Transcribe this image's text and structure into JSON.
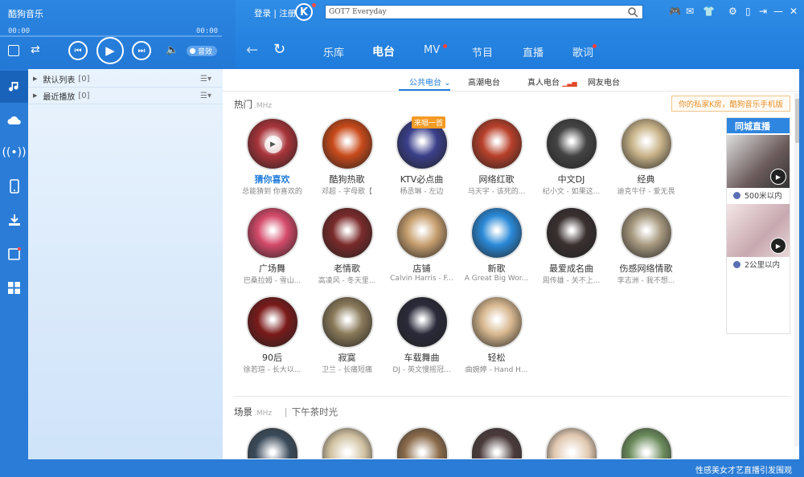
{
  "app": {
    "title": "酷狗音乐"
  },
  "player": {
    "time_current": "00:00",
    "time_total": "00:00",
    "fx_label": "音效"
  },
  "header": {
    "login": "登录",
    "divider": "|",
    "register": "注册",
    "search_value": "GOT7 Everyday"
  },
  "tabs": [
    {
      "label": "乐库"
    },
    {
      "label": "电台"
    },
    {
      "label": "MV"
    },
    {
      "label": "节目"
    },
    {
      "label": "直播"
    },
    {
      "label": "歌词"
    }
  ],
  "playlist": {
    "items": [
      {
        "label": "默认列表",
        "count": "[0]"
      },
      {
        "label": "最近播放",
        "count": "[0]"
      }
    ]
  },
  "subtabs": [
    {
      "label": "公共电台"
    },
    {
      "label": "高潮电台"
    },
    {
      "label": "真人电台"
    },
    {
      "label": "网友电台"
    }
  ],
  "sections": {
    "hot": {
      "title": "热门",
      "sub": ".MHz"
    },
    "scene": {
      "title": "场景",
      "sub": ".MHz",
      "tag": "下午茶时光"
    }
  },
  "promo": "你的私家K房，酷狗音乐手机版",
  "stations": [
    {
      "title": "猜你喜欢",
      "sub": "总能猜到 你喜欢的",
      "color": "#a8343a"
    },
    {
      "title": "酷狗热歌",
      "sub": "邓超 - 字母歌【",
      "color": "#c94a1a"
    },
    {
      "title": "KTV必点曲",
      "sub": "杨丞琳 - 左边",
      "color": "#3a3f8a",
      "badge": "来唱一首"
    },
    {
      "title": "网络红歌",
      "sub": "马天宇 - 该死的...",
      "color": "#b8402a"
    },
    {
      "title": "中文DJ",
      "sub": "纪小文 - 如果这...",
      "color": "#444"
    },
    {
      "title": "经典",
      "sub": "迪克牛仔 - 爱无畏",
      "color": "#c9b48a"
    },
    {
      "title": "广场舞",
      "sub": "巴桑拉姆 - 雪山...",
      "color": "#d44a6a"
    },
    {
      "title": "老情歌",
      "sub": "高凌风 - 冬天里...",
      "color": "#7a2a2a"
    },
    {
      "title": "店铺",
      "sub": "Calvin Harris - F...",
      "color": "#c8a070"
    },
    {
      "title": "新歌",
      "sub": "A Great Big Wor...",
      "color": "#2a8ad8"
    },
    {
      "title": "最爱成名曲",
      "sub": "周传雄 - 关不上...",
      "color": "#3a3030"
    },
    {
      "title": "伤感网络情歌",
      "sub": "李志洲 - 我不想...",
      "color": "#a89a80"
    },
    {
      "title": "90后",
      "sub": "徐若瑄 - 长大以...",
      "color": "#7a1a1a"
    },
    {
      "title": "寂寞",
      "sub": "卫兰 - 长痛短痛",
      "color": "#8a7a5a"
    },
    {
      "title": "车载舞曲",
      "sub": "DJ - 英文慢摇冠...",
      "color": "#2a2a3a"
    },
    {
      "title": "轻松",
      "sub": "曲婉婷 - Hand H...",
      "color": "#d8b890"
    }
  ],
  "live": {
    "title": "同城直播",
    "entries": [
      {
        "distance": "500米以内"
      },
      {
        "distance": "2公里以内"
      }
    ]
  },
  "footer": {
    "text": "性感美女才艺直播引发围观"
  }
}
